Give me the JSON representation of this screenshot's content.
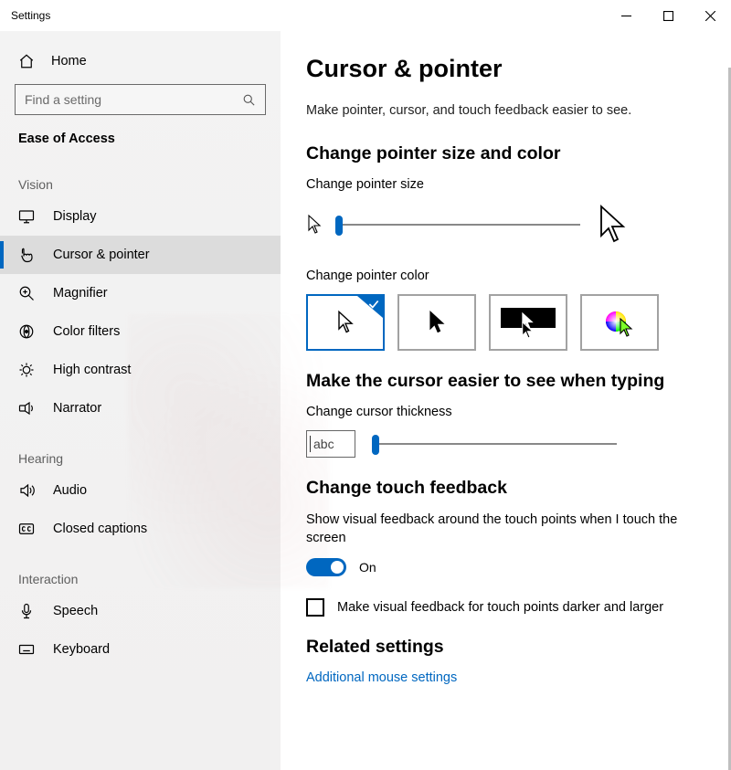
{
  "window": {
    "title": "Settings"
  },
  "captions": {
    "min": "–",
    "max_icon": "",
    "close": ""
  },
  "sidebar": {
    "home_label": "Home",
    "search_placeholder": "Find a setting",
    "section_title": "Ease of Access",
    "groups": {
      "vision": {
        "label": "Vision",
        "items": [
          {
            "id": "display",
            "label": "Display"
          },
          {
            "id": "cursor",
            "label": "Cursor & pointer",
            "active": true
          },
          {
            "id": "magnifier",
            "label": "Magnifier"
          },
          {
            "id": "colorflt",
            "label": "Color filters"
          },
          {
            "id": "contrast",
            "label": "High contrast"
          },
          {
            "id": "narrator",
            "label": "Narrator"
          }
        ]
      },
      "hearing": {
        "label": "Hearing",
        "items": [
          {
            "id": "audio",
            "label": "Audio"
          },
          {
            "id": "caption",
            "label": "Closed captions"
          }
        ]
      },
      "interaction": {
        "label": "Interaction",
        "items": [
          {
            "id": "speech",
            "label": "Speech"
          },
          {
            "id": "keyboard",
            "label": "Keyboard"
          }
        ]
      }
    }
  },
  "main": {
    "title": "Cursor & pointer",
    "subtitle": "Make pointer, cursor, and touch feedback easier to see.",
    "section_size_color": "Change pointer size and color",
    "label_pointer_size": "Change pointer size",
    "label_pointer_color": "Change pointer color",
    "color_options": [
      "white",
      "black",
      "inverted",
      "custom"
    ],
    "color_selected": "white",
    "section_cursor": "Make the cursor easier to see when typing",
    "label_cursor_thickness": "Change cursor thickness",
    "abc_sample": "abc",
    "section_touch": "Change touch feedback",
    "touch_desc": "Show visual feedback around the touch points when I touch the screen",
    "toggle_state": "On",
    "touch_darker_larger": "Make visual feedback for touch points darker and larger",
    "section_related": "Related settings",
    "link_mouse": "Additional mouse settings"
  }
}
